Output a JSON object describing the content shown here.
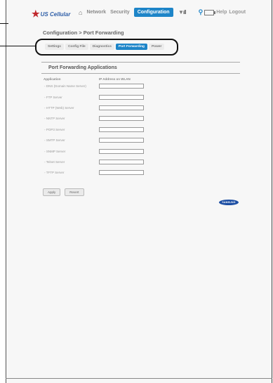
{
  "brand": {
    "logo": "US Cellular"
  },
  "nav": {
    "items": [
      "Network",
      "Security"
    ],
    "active": "Configuration"
  },
  "status": {
    "help": "Help",
    "logout": "Logout"
  },
  "page": {
    "title": "Configuration > Port Forwarding"
  },
  "tabs": [
    {
      "label": "Settings",
      "active": false
    },
    {
      "label": "Config File",
      "active": false
    },
    {
      "label": "Diagnostics",
      "active": false
    },
    {
      "label": "Port Forwarding",
      "active": true
    },
    {
      "label": "Power",
      "active": false
    }
  ],
  "panel": {
    "title": "Port Forwarding Applications",
    "col_application": "Application",
    "col_ip": "IP Address on WLAN",
    "rows": [
      {
        "label": "DNS (Domain Name Server)",
        "value": ""
      },
      {
        "label": "FTP Server",
        "value": ""
      },
      {
        "label": "HTTP (Web) Server",
        "value": ""
      },
      {
        "label": "NNTP Server",
        "value": ""
      },
      {
        "label": "POP3 Server",
        "value": ""
      },
      {
        "label": "SMTP Server",
        "value": ""
      },
      {
        "label": "SNMP Server",
        "value": ""
      },
      {
        "label": "Telnet Server",
        "value": ""
      },
      {
        "label": "TFTP Server",
        "value": ""
      }
    ]
  },
  "buttons": {
    "apply": "Apply",
    "revert": "Revert"
  },
  "footer_brand": "SAMSUNG"
}
